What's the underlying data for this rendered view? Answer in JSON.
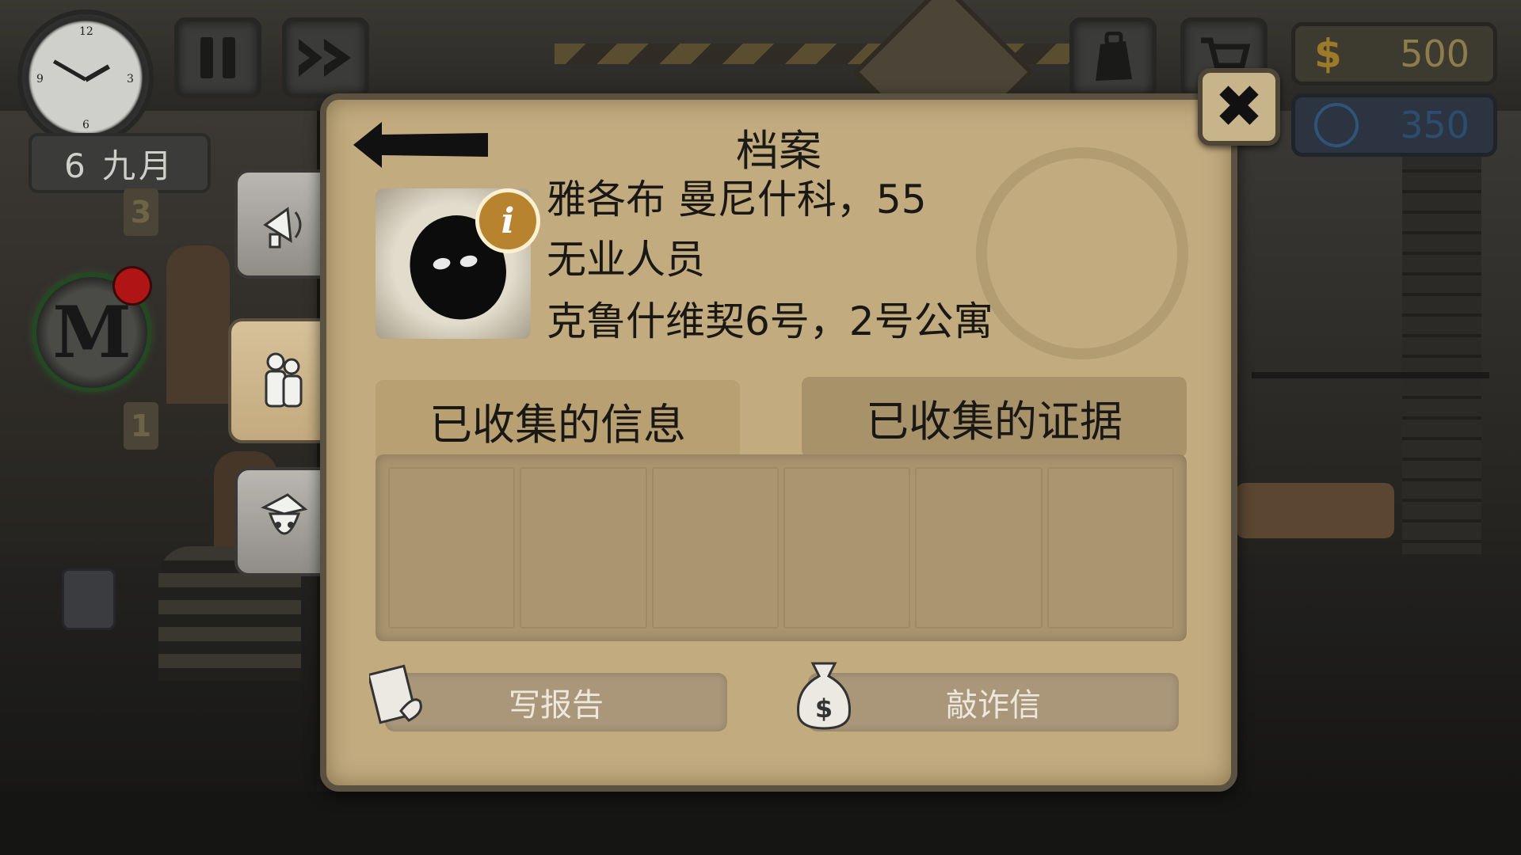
{
  "hud": {
    "date": "6 九月",
    "money": "500",
    "money_symbol": "$",
    "reputation": "350",
    "floor_numbers": [
      "3",
      "1"
    ]
  },
  "dossier": {
    "title": "档案",
    "name_line": "雅各布  曼尼什科，55",
    "occupation": "无业人员",
    "address": "克鲁什维契6号，2号公寓",
    "info_badge": "i",
    "tabs": {
      "collected_info": "已收集的信息",
      "collected_evidence": "已收集的证据"
    },
    "actions": {
      "write_report": "写报告",
      "blackmail_letter": "敲诈信"
    },
    "close_symbol": "✖"
  },
  "colors": {
    "panel": "#c2ab7f",
    "panel_border": "#5b5141",
    "money_text": "#8e7d4c",
    "reputation_text": "#2e4d6e"
  },
  "icons": [
    "clock-icon",
    "pause-icon",
    "fast-forward-icon",
    "inventory-bag-icon",
    "cart-icon",
    "coin-icon",
    "reputation-emblem-icon",
    "megaphone-icon",
    "tenants-icon",
    "officer-icon",
    "report-icon",
    "money-bag-icon",
    "back-arrow-icon",
    "close-icon",
    "info-icon"
  ]
}
